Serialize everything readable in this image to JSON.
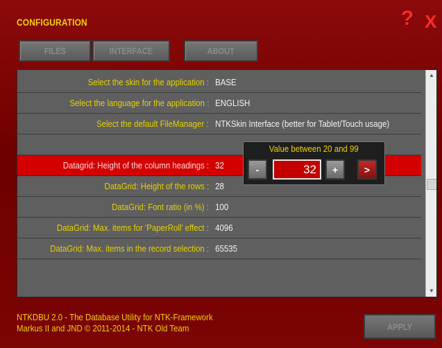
{
  "header": {
    "title": "CONFIGURATION",
    "help_label": "?",
    "close_label": "X"
  },
  "tabs": [
    {
      "label": "FILES"
    },
    {
      "label": "INTERFACE"
    },
    {
      "label": "ABOUT"
    }
  ],
  "settings": [
    {
      "label": "Select the skin for the application :",
      "value": "BASE"
    },
    {
      "label": "Select the language for the application :",
      "value": "ENGLISH"
    },
    {
      "label": "Select the default FileManager :",
      "value": "NTKSkin Interface (better for Tablet/Touch usage)"
    },
    {
      "label": "",
      "value": ""
    },
    {
      "label": "Datagrid: Height of the column headings :",
      "value": "32",
      "selected": true
    },
    {
      "label": "DataGrid: Height of the rows :",
      "value": "28"
    },
    {
      "label": "DataGrid: Font ratio (in %) :",
      "value": "100"
    },
    {
      "label": "DataGrid: Max. items for 'PaperRoll' effect :",
      "value": "4096"
    },
    {
      "label": "DataGrid: Max. items in the record selection :",
      "value": "65535"
    }
  ],
  "popup": {
    "title": "Value between 20 and 99",
    "value": "32",
    "decrement_label": "-",
    "increment_label": "+",
    "confirm_label": ">"
  },
  "footer": {
    "line1": "NTKDBU 2.0 - The Database Utility for NTK-Framework",
    "line2": "Markus II and JND  © 2011-2014 - NTK Old Team"
  },
  "apply_label": "APPLY",
  "scrollbar": {
    "up_icon": "▲",
    "down_icon": "▼"
  },
  "colors": {
    "background": "#7a0000",
    "accent_yellow": "#f0d000",
    "selected_row": "#d40000",
    "panel": "#5f5f5f"
  }
}
